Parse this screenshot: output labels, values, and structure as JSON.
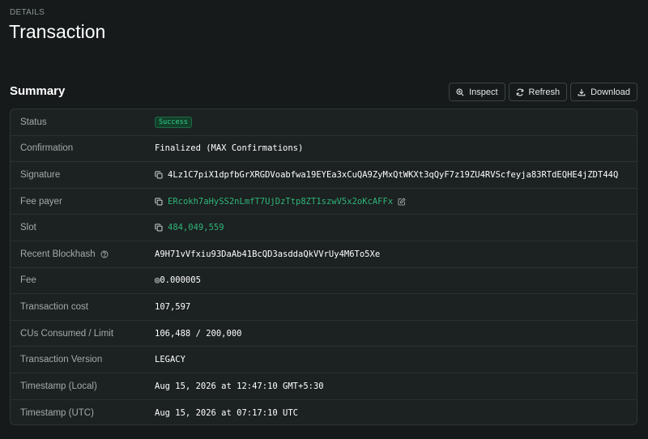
{
  "header": {
    "eyebrow": "DETAILS",
    "title": "Transaction"
  },
  "summary": {
    "title": "Summary",
    "buttons": {
      "inspect": "Inspect",
      "refresh": "Refresh",
      "download": "Download"
    }
  },
  "rows": {
    "status": {
      "label": "Status",
      "value": "Success"
    },
    "confirmation": {
      "label": "Confirmation",
      "value": "Finalized (MAX Confirmations)"
    },
    "signature": {
      "label": "Signature",
      "value": "4Lz1C7piX1dpfbGrXRGDVoabfwa19EYEa3xCuQA9ZyMxQtWKXt3qQyF7z19ZU4RVScfeyja83RTdEQHE4jZDT44Q"
    },
    "fee_payer": {
      "label": "Fee payer",
      "value": "ERcokh7aHySS2nLmfT7UjDzTtp8ZT1szwV5x2oKcAFFx"
    },
    "slot": {
      "label": "Slot",
      "value": "484,049,559"
    },
    "recent_blockhash": {
      "label": "Recent Blockhash",
      "value": "A9H71vVfxiu93DaAb41BcQD3asddaQkVVrUy4M6To5Xe"
    },
    "fee": {
      "label": "Fee",
      "value": "◎0.000005"
    },
    "transaction_cost": {
      "label": "Transaction cost",
      "value": "107,597"
    },
    "cus_consumed": {
      "label": "CUs Consumed / Limit",
      "value": "106,488 / 200,000"
    },
    "transaction_version": {
      "label": "Transaction Version",
      "value": "LEGACY"
    },
    "timestamp_local": {
      "label": "Timestamp (Local)",
      "value": "Aug 15, 2026 at 12:47:10 GMT+5:30"
    },
    "timestamp_utc": {
      "label": "Timestamp (UTC)",
      "value": "Aug 15, 2026 at 07:17:10 UTC"
    }
  },
  "colors": {
    "background": "#161a1a",
    "card": "#1c2121",
    "accent_link": "#2fb57a",
    "success_badge_bg": "#123f2a",
    "success_badge_text": "#35d08a"
  },
  "icons": {
    "inspect": "zoom-in-icon",
    "refresh": "refresh-icon",
    "download": "download-icon",
    "copy": "copy-icon",
    "edit": "edit-icon",
    "help": "help-circle-icon"
  }
}
